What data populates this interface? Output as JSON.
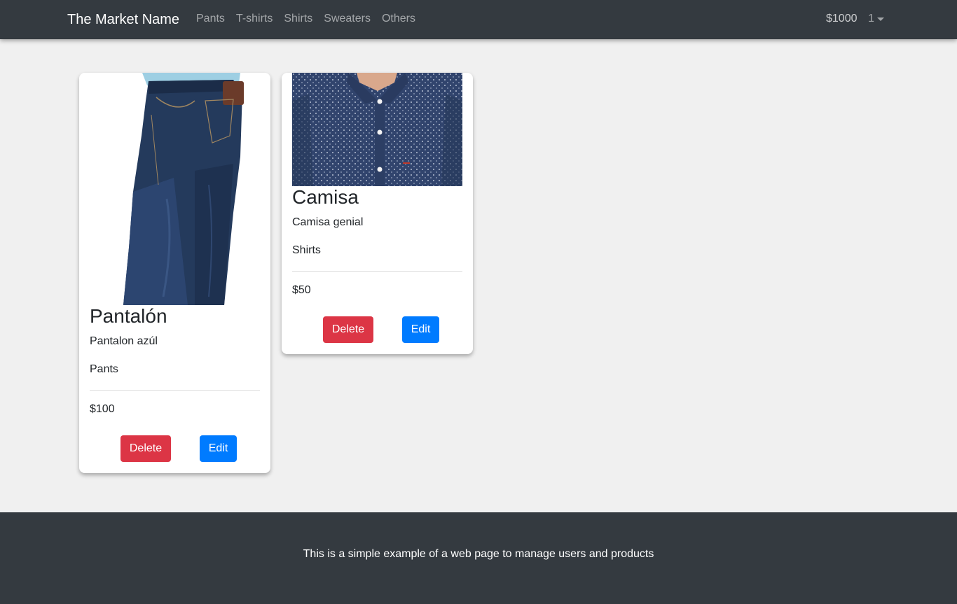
{
  "navbar": {
    "brand": "The Market Name",
    "links": [
      "Pants",
      "T-shirts",
      "Shirts",
      "Sweaters",
      "Others"
    ],
    "balance": "$1000",
    "user_menu": "1"
  },
  "products": [
    {
      "image_icon": "jeans-image",
      "title": "Pantalón",
      "description": "Pantalon azúl",
      "category": "Pants",
      "price": "$100",
      "delete_label": "Delete",
      "edit_label": "Edit"
    },
    {
      "image_icon": "shirt-image",
      "title": "Camisa",
      "description": "Camisa genial",
      "category": "Shirts",
      "price": "$50",
      "delete_label": "Delete",
      "edit_label": "Edit"
    }
  ],
  "footer": {
    "text": "This is a simple example of a web page to manage users and products"
  },
  "colors": {
    "navbar_bg": "#343a40",
    "page_bg": "#f0f0f0",
    "delete": "#dc3545",
    "edit": "#007bff"
  }
}
